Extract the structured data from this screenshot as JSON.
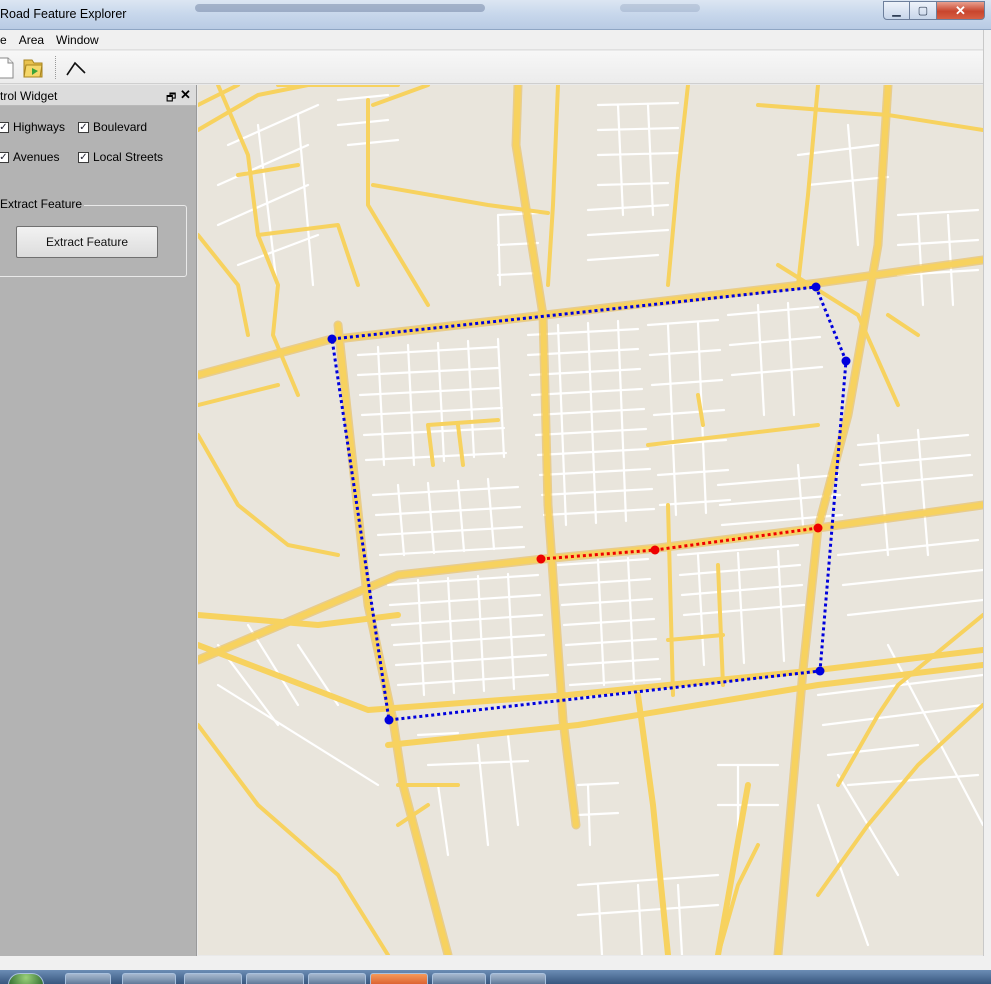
{
  "window": {
    "title": "Road Feature Explorer"
  },
  "menubar": {
    "items": [
      "e",
      "Area",
      "Window"
    ]
  },
  "toolbar": {
    "buttons": [
      {
        "icon": "new-document-icon"
      },
      {
        "icon": "open-folder-icon"
      },
      {
        "icon": "draw-polyline-icon"
      }
    ]
  },
  "dock": {
    "title": "trol Widget",
    "float_symbol": "🗗",
    "close_symbol": "✕",
    "road_types": {
      "highways": {
        "label": "Highways",
        "checked": true
      },
      "boulevard": {
        "label": "Boulevard",
        "checked": true
      },
      "avenues": {
        "label": "Avenues",
        "checked": true
      },
      "local_streets": {
        "label": "Local Streets",
        "checked": true
      }
    },
    "extract_group": {
      "title": "Extract Feature",
      "button_label": "Extract Feature"
    }
  },
  "map": {
    "colors": {
      "background": "#e9e5dc",
      "major_road": "#f7d25f",
      "minor_road": "#ffffff",
      "area_polygon": "#0000dd",
      "selected_segment": "#ee0000"
    }
  },
  "taskbar": {
    "items": 7
  }
}
